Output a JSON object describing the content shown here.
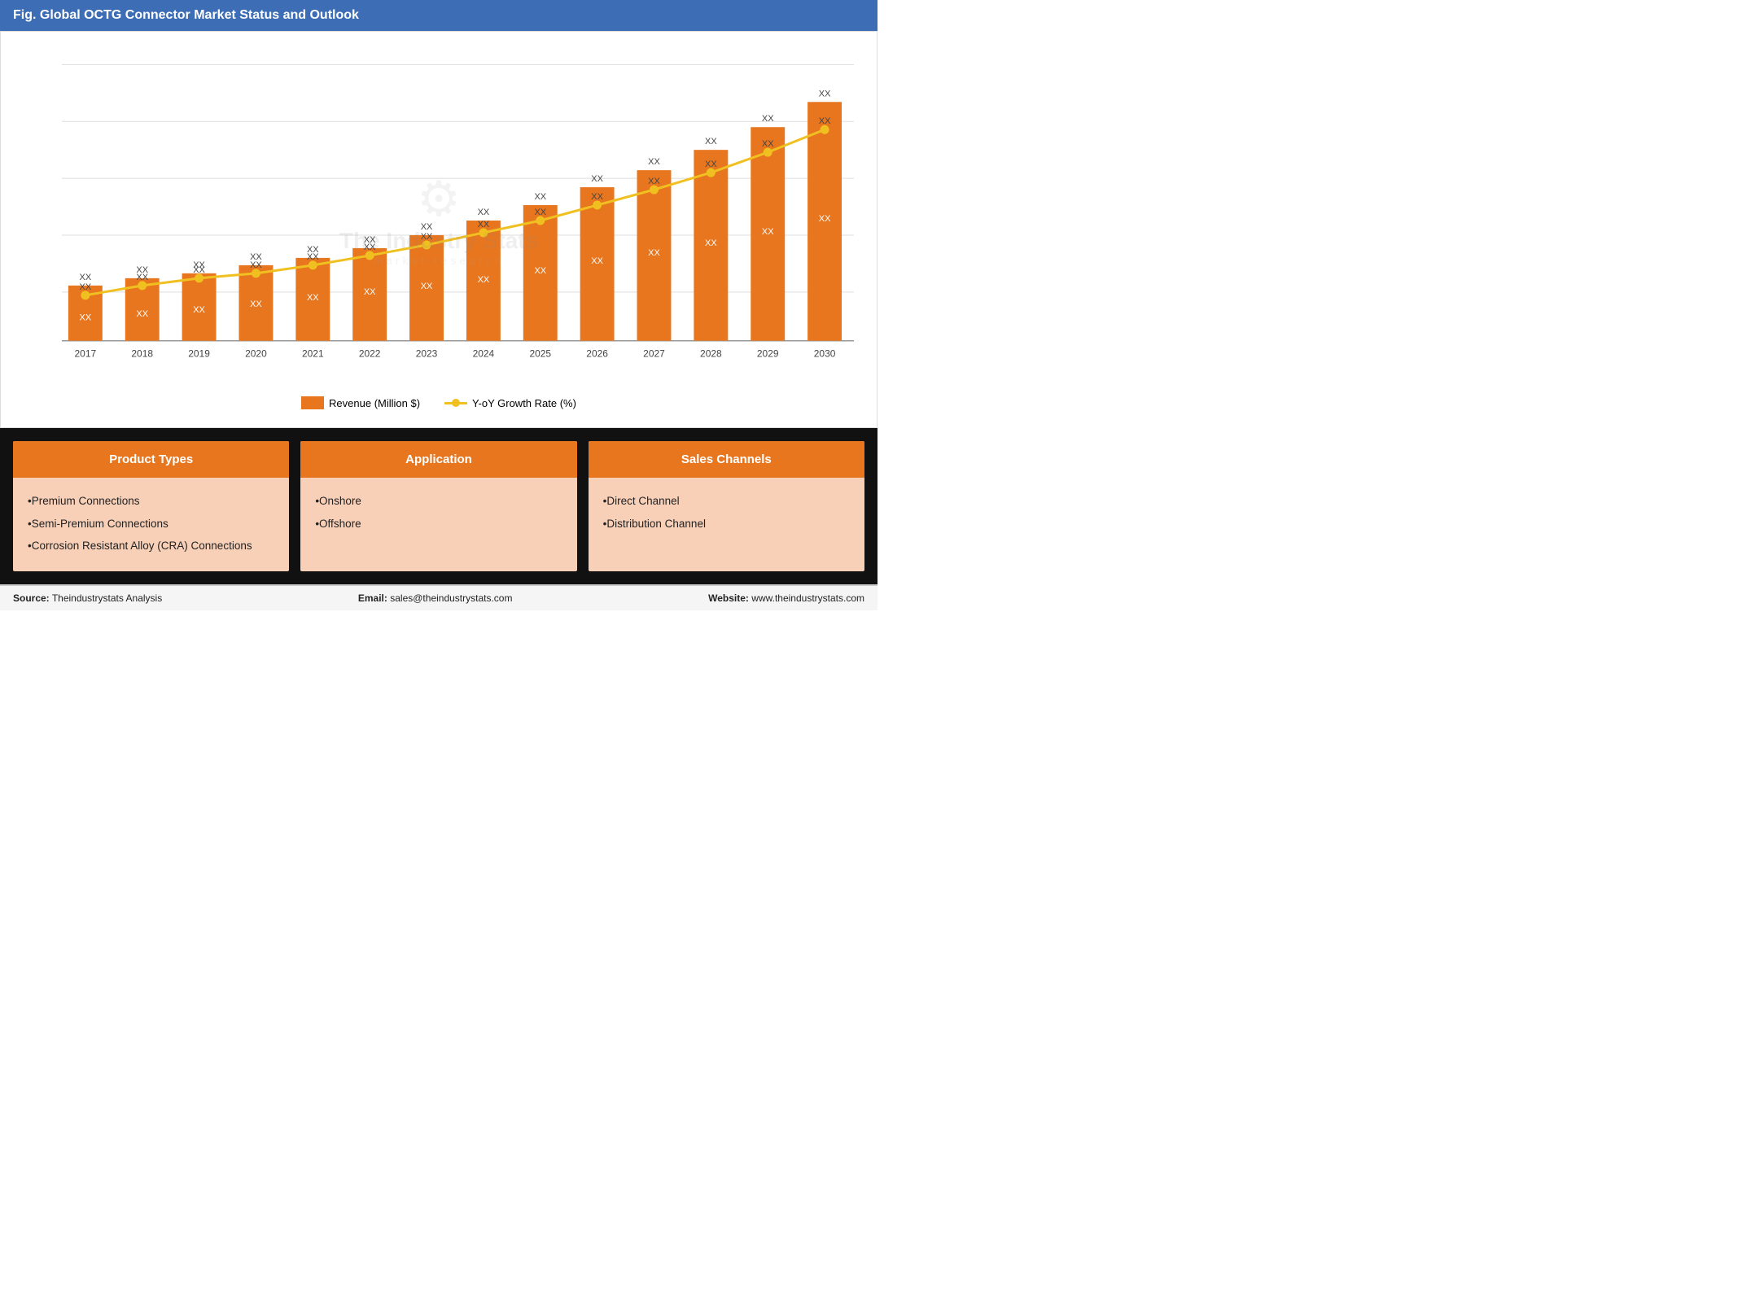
{
  "header": {
    "title": "Fig. Global OCTG Connector Market Status and Outlook"
  },
  "chart": {
    "years": [
      "2017",
      "2018",
      "2019",
      "2020",
      "2021",
      "2022",
      "2023",
      "2024",
      "2025",
      "2026",
      "2027",
      "2028",
      "2029",
      "2030"
    ],
    "bar_label": "XX",
    "line_label": "XX",
    "bar_values": [
      22,
      25,
      27,
      30,
      33,
      37,
      42,
      48,
      54,
      61,
      68,
      76,
      85,
      95
    ],
    "line_values": [
      18,
      22,
      25,
      27,
      30,
      34,
      38,
      43,
      48,
      54,
      60,
      67,
      75,
      84
    ],
    "y_max": 110,
    "legend": {
      "bar_label": "Revenue (Million $)",
      "line_label": "Y-oY Growth Rate (%)"
    }
  },
  "cards": [
    {
      "id": "product-types",
      "header": "Product Types",
      "items": [
        "•Premium Connections",
        "•Semi-Premium Connections",
        "•Corrosion Resistant Alloy (CRA) Connections"
      ]
    },
    {
      "id": "application",
      "header": "Application",
      "items": [
        "•Onshore",
        "•Offshore"
      ]
    },
    {
      "id": "sales-channels",
      "header": "Sales Channels",
      "items": [
        "•Direct Channel",
        "•Distribution Channel"
      ]
    }
  ],
  "footer": {
    "source_label": "Source:",
    "source_value": "Theindustrystats Analysis",
    "email_label": "Email:",
    "email_value": "sales@theindustrystats.com",
    "website_label": "Website:",
    "website_value": "www.theindustrystats.com"
  },
  "watermark": {
    "title": "The Industry Stats",
    "subtitle": "market  research"
  },
  "colors": {
    "header_bg": "#3d6db5",
    "bar_color": "#e8761e",
    "line_color": "#f0c020",
    "card_header_bg": "#e8761e",
    "card_body_bg": "#f8d0b8",
    "footer_bg": "#f5f5f5",
    "dark_section_bg": "#111"
  }
}
